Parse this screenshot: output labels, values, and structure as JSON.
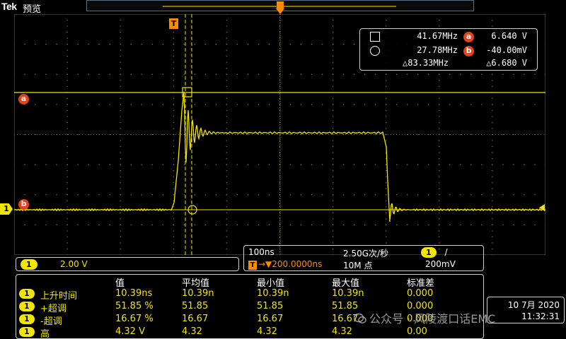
{
  "header": {
    "brand": "Tek",
    "mode": "预览"
  },
  "cursor_readout": {
    "row1": {
      "freq": "41.67MHz",
      "badge": "a",
      "volt": "6.640 V"
    },
    "row2": {
      "freq": "27.78MHz",
      "badge": "b",
      "volt": "-40.00mV"
    },
    "delta": {
      "freq": "△83.33MHz",
      "volt": "△6.680 V"
    }
  },
  "markers": {
    "trigger": "T",
    "cursor_a": "a",
    "cursor_b": "b",
    "channel": "1"
  },
  "channel_scale": {
    "channel": "1",
    "value": "2.00 V"
  },
  "horizontal": {
    "scale": "100ns",
    "sample_rate": "2.50G次/秒",
    "trigger_badge": "T",
    "trigger_position": "→▼200.0000ns",
    "record_length": "10M 点",
    "trig_channel": "1",
    "trig_slope": "/",
    "trig_level": "200mV"
  },
  "measurements": {
    "headers": [
      "值",
      "平均值",
      "最小值",
      "最大值",
      "标准差"
    ],
    "rows": [
      {
        "ch": "1",
        "label": "上升时间",
        "value": "10.39ns",
        "mean": "10.39n",
        "min": "10.39n",
        "max": "10.39n",
        "std": "0.000"
      },
      {
        "ch": "1",
        "label": "+超调",
        "value": "51.85 %",
        "mean": "51.85",
        "min": "51.85",
        "max": "51.85",
        "std": "0.000"
      },
      {
        "ch": "1",
        "label": "-超调",
        "value": "16.67 %",
        "mean": "16.67",
        "min": "16.67",
        "max": "16.67",
        "std": "0.000"
      },
      {
        "ch": "1",
        "label": "高",
        "value": "4.32 V",
        "mean": "4.32",
        "min": "4.32",
        "max": "4.32",
        "std": "0.00"
      }
    ]
  },
  "datetime": {
    "date": "10 7月 2020",
    "time": "11:32:31"
  },
  "watermark": {
    "text": "公众号 · 风陵渡口话EMC"
  },
  "colors": {
    "trace": "#f2e600",
    "cursor_badge": "#e84018",
    "trigger": "#ff8a00"
  }
}
